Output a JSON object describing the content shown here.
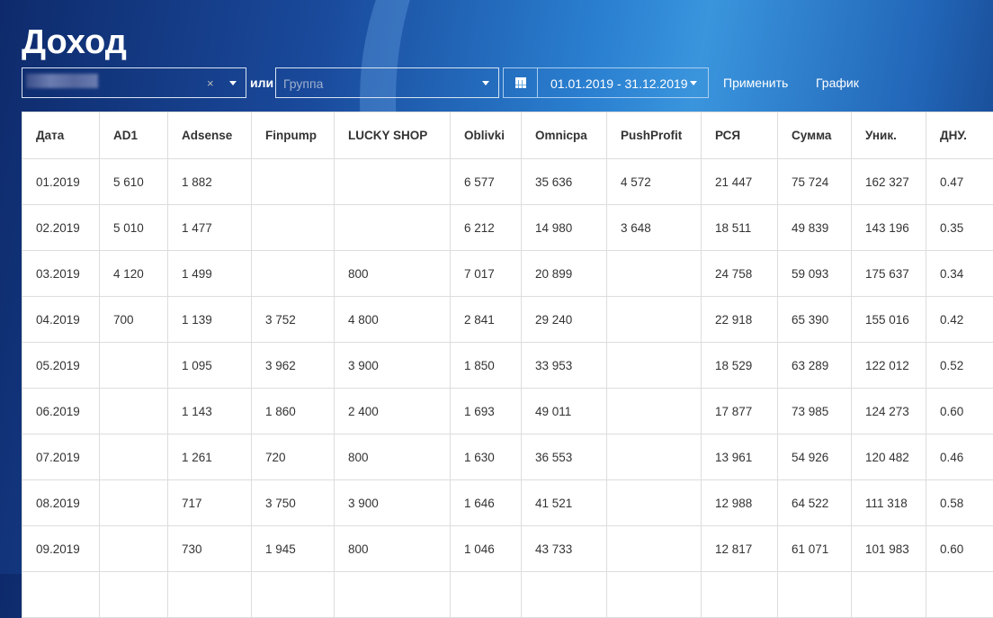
{
  "title": "Доход",
  "filters": {
    "or_label": "или",
    "group_placeholder": "Группа",
    "clear": "×",
    "date_range": "01.01.2019 - 31.12.2019",
    "apply": "Применить",
    "chart": "График"
  },
  "table": {
    "headers": [
      "Дата",
      "AD1",
      "Adsense",
      "Finpump",
      "LUCKY SHOP",
      "Oblivki",
      "Omnicpa",
      "PushProfit",
      "РСЯ",
      "Сумма",
      "Уник.",
      "ДНУ."
    ],
    "rows": [
      [
        "01.2019",
        "5 610",
        "1 882",
        "",
        "",
        "6 577",
        "35 636",
        "4 572",
        "21 447",
        "75 724",
        "162 327",
        "0.47"
      ],
      [
        "02.2019",
        "5 010",
        "1 477",
        "",
        "",
        "6 212",
        "14 980",
        "3 648",
        "18 511",
        "49 839",
        "143 196",
        "0.35"
      ],
      [
        "03.2019",
        "4 120",
        "1 499",
        "",
        "800",
        "7 017",
        "20 899",
        "",
        "24 758",
        "59 093",
        "175 637",
        "0.34"
      ],
      [
        "04.2019",
        "700",
        "1 139",
        "3 752",
        "4 800",
        "2 841",
        "29 240",
        "",
        "22 918",
        "65 390",
        "155 016",
        "0.42"
      ],
      [
        "05.2019",
        "",
        "1 095",
        "3 962",
        "3 900",
        "1 850",
        "33 953",
        "",
        "18 529",
        "63 289",
        "122 012",
        "0.52"
      ],
      [
        "06.2019",
        "",
        "1 143",
        "1 860",
        "2 400",
        "1 693",
        "49 011",
        "",
        "17 877",
        "73 985",
        "124 273",
        "0.60"
      ],
      [
        "07.2019",
        "",
        "1 261",
        "720",
        "800",
        "1 630",
        "36 553",
        "",
        "13 961",
        "54 926",
        "120 482",
        "0.46"
      ],
      [
        "08.2019",
        "",
        "717",
        "3 750",
        "3 900",
        "1 646",
        "41 521",
        "",
        "12 988",
        "64 522",
        "111 318",
        "0.58"
      ],
      [
        "09.2019",
        "",
        "730",
        "1 945",
        "800",
        "1 046",
        "43 733",
        "",
        "12 817",
        "61 071",
        "101 983",
        "0.60"
      ],
      [
        "",
        "",
        "",
        "",
        "",
        "",
        "",
        "",
        "",
        "",
        "",
        ""
      ]
    ]
  }
}
